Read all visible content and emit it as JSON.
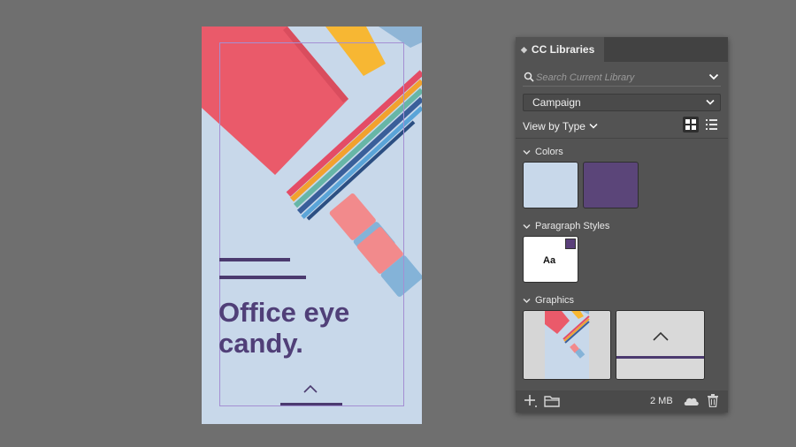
{
  "artboard": {
    "headline": "Office eye candy.",
    "background_color": "#c8d8ea",
    "accent_color": "#503f78"
  },
  "panel": {
    "tab_title": "CC Libraries",
    "search": {
      "placeholder": "Search Current Library",
      "value": ""
    },
    "library": {
      "selected": "Campaign"
    },
    "view_by": {
      "label": "View by Type"
    },
    "sections": {
      "colors": {
        "label": "Colors",
        "swatches": [
          "#c8d8ea",
          "#5b4579"
        ]
      },
      "paragraph_styles": {
        "label": "Paragraph Styles",
        "preview_text": "Aa"
      },
      "graphics": {
        "label": "Graphics"
      }
    },
    "footer": {
      "storage": "2 MB"
    }
  },
  "icons": [
    "search-icon",
    "chevron-down-icon",
    "grid-view-icon",
    "list-view-icon",
    "add-icon",
    "folder-icon",
    "cloud-icon",
    "trash-icon",
    "chevron-up-icon"
  ]
}
